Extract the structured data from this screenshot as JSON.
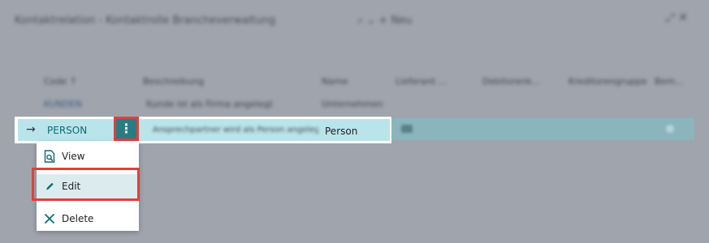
{
  "header": {
    "breadcrumb": "Kontaktrelation - Kontaktrolle Brancheverwaltung",
    "tools": "⌕ ⌄   + Neu",
    "right_icons": "⤢ ✕"
  },
  "table": {
    "columns": [
      "Code ↑",
      "Beschreibung",
      "Name",
      "Lieferant ...",
      "Debitorenk...",
      "Kreditorengruppe",
      "Bem..."
    ],
    "first_row": {
      "code": "KUNDEN",
      "description": "Kunde ist als Firma angelegt",
      "name": "Unternehmen"
    },
    "focused_row": {
      "arrow": "→",
      "code": "PERSON",
      "description": "Ansprechpartner wird als Person angelegt",
      "name": "Person",
      "kebab": "⋮"
    }
  },
  "menu": {
    "items": [
      {
        "label": "View",
        "icon": "view-icon"
      },
      {
        "label": "Edit",
        "icon": "edit-icon"
      },
      {
        "label": "Delete",
        "icon": "delete-icon"
      }
    ]
  },
  "colors": {
    "overlay": "#a0a4ad",
    "row_highlight": "#b9e4ea",
    "accent": "#0b6a75",
    "callout": "#e0403a"
  }
}
